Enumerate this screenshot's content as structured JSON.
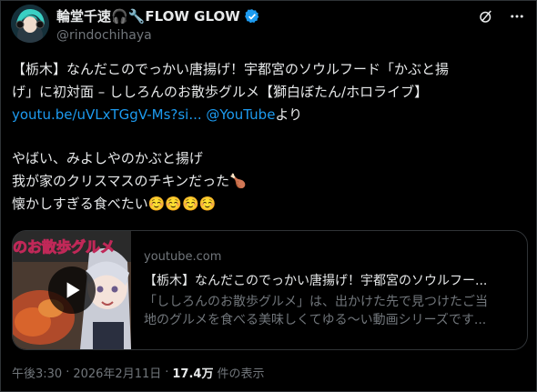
{
  "author": {
    "display_name": "輪堂千速🎧🔧FLOW GLOW",
    "handle": "@rindochihaya",
    "verified": true,
    "verified_color": "#1d9bf0"
  },
  "post": {
    "line1": "【栃木】なんだこのでっかい唐揚げ！宇都宮のソウルフード「かぶと揚",
    "line2": "げ」に初対面 – ししろんのお散歩グルメ【獅白ぼたん/ホロライブ】",
    "link_text": "youtu.be/uVLxTGgV-Ms?si...",
    "mention": "@YouTube",
    "after_mention": "より",
    "line4": "やばい、みよしやのかぶと揚げ",
    "line5": "我が家のクリスマスのチキンだった🍗",
    "line6": "懐かしすぎる食べたい☺️☺️☺️☺️"
  },
  "card": {
    "thumb_caption": "のお散歩グルメ",
    "domain": "youtube.com",
    "title": "【栃木】なんだこのでっかい唐揚げ！宇都宮のソウルフー...",
    "desc_line1": "「ししろんのお散歩グルメ」は、出かけた先で見つけたご当",
    "desc_line2": "地のグルメを食べる美味しくてゆる～い動画シリーズです..."
  },
  "footer": {
    "time": "午後3:30",
    "sep1": "·",
    "date": "2026年2月11日",
    "sep2": "·",
    "views": "17.4万",
    "views_label": "件の表示"
  },
  "icons": {
    "grok": "grok-icon",
    "more": "more-icon",
    "play": "play-icon"
  },
  "colors": {
    "background": "#000000",
    "text": "#e7e9ea",
    "muted": "#71767b",
    "link": "#1d9bf0",
    "border": "#2f3336"
  }
}
